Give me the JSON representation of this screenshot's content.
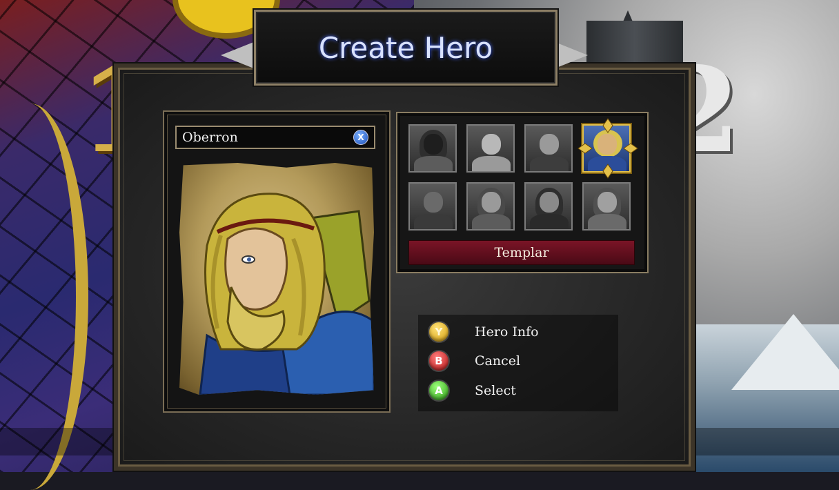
{
  "screen": {
    "title": "Create Hero",
    "background_numbers": {
      "left": "1",
      "right": "2"
    }
  },
  "hero": {
    "name": "Oberron",
    "rename_button": "X",
    "portrait_icon": "bearded-blonde-warrior-portrait"
  },
  "hero_grid": {
    "selected_index": 3,
    "selected_class": "Templar",
    "slots": [
      {
        "icon": "hooded-rogue-icon"
      },
      {
        "icon": "barbarian-icon"
      },
      {
        "icon": "mohawk-warrior-icon"
      },
      {
        "icon": "templar-icon"
      },
      {
        "icon": "masked-assassin-icon"
      },
      {
        "icon": "female-archer-icon"
      },
      {
        "icon": "hooded-woman-icon"
      },
      {
        "icon": "female-knight-icon"
      }
    ]
  },
  "legend": {
    "items": [
      {
        "button": "Y",
        "label": "Hero Info",
        "color": "#e3b21c"
      },
      {
        "button": "B",
        "label": "Cancel",
        "color": "#c41a1a"
      },
      {
        "button": "A",
        "label": "Select",
        "color": "#39b61a"
      }
    ]
  },
  "colors": {
    "title_text": "#d9e2ff",
    "class_bar": "#7a1426",
    "selection_frame": "#e4c14a"
  }
}
